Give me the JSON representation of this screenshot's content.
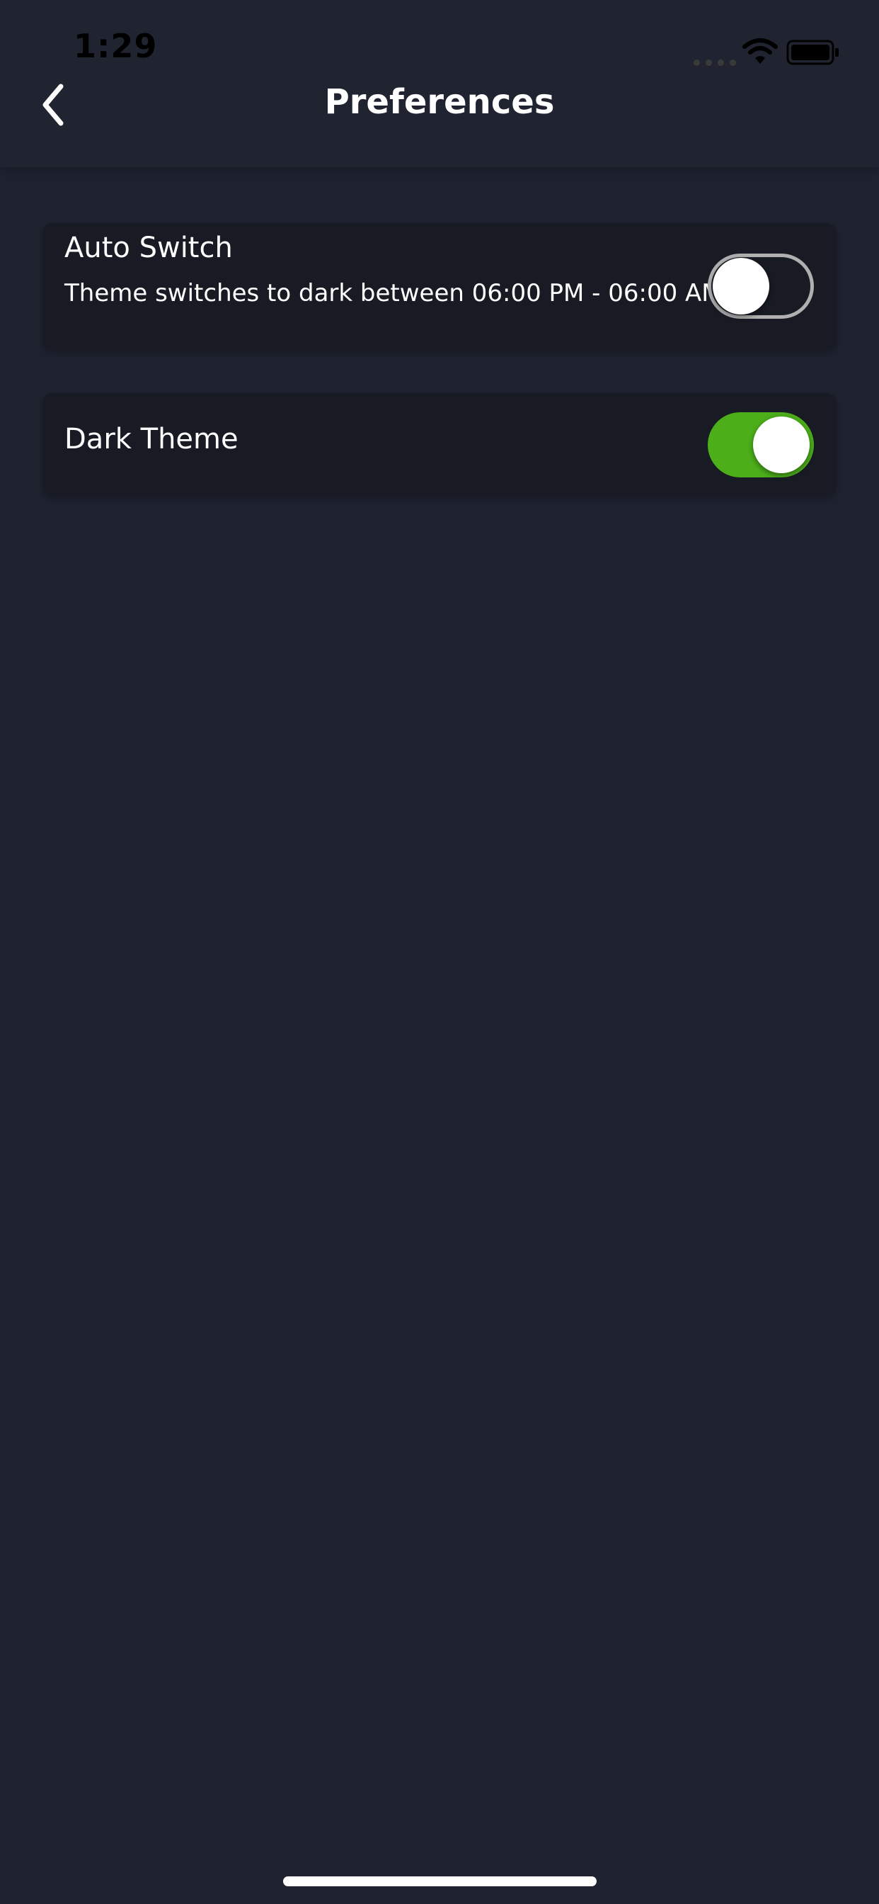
{
  "status_bar": {
    "time": "1:29"
  },
  "header": {
    "title": "Preferences",
    "back_icon": "chevron-left-icon"
  },
  "settings": [
    {
      "title": "Auto Switch",
      "description": "Theme switches to dark between 06:00 PM - 06:00 AM",
      "enabled": false
    },
    {
      "title": "Dark Theme",
      "enabled": true
    }
  ],
  "colors": {
    "background": "#1f2330",
    "card": "#181b24",
    "toggle_on": "#4caf1a",
    "toggle_off_border": "#b0b0b0"
  }
}
